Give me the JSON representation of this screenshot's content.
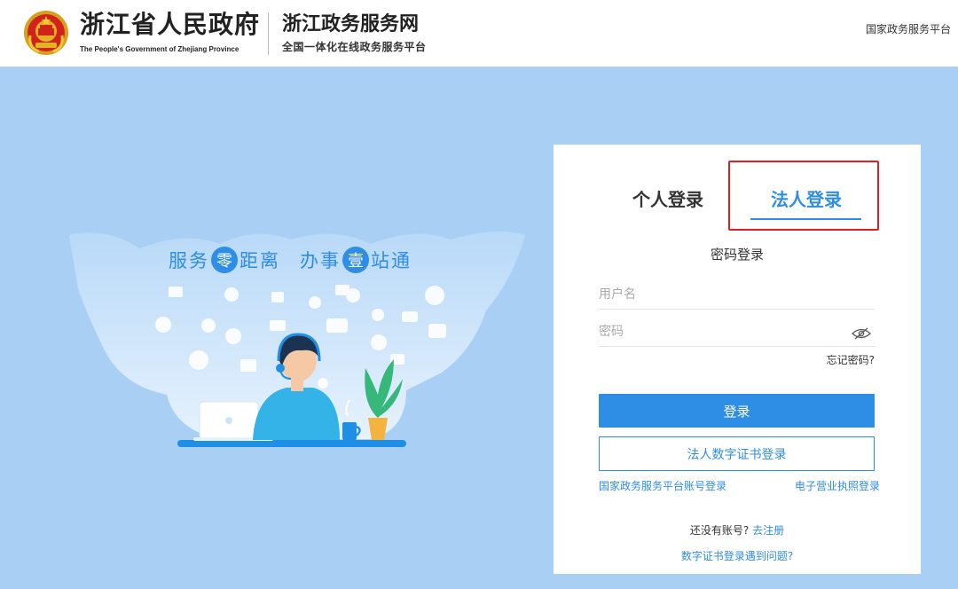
{
  "header": {
    "gov_name": "浙江省人民政府",
    "gov_name_en": "The People's Government of Zhejiang Province",
    "site_name": "浙江政务服务网",
    "site_subtitle": "全国一体化在线政务服务平台",
    "national_platform_link": "国家政务服务平台",
    "emblem_icon": "national-emblem-icon"
  },
  "banner": {
    "slogan_part1": "服务",
    "slogan_circle1": "零",
    "slogan_part2": "距离",
    "slogan_part3": "办事",
    "slogan_circle2": "壹",
    "slogan_part4": "站通"
  },
  "login": {
    "tabs": [
      {
        "label": "个人登录",
        "active": false
      },
      {
        "label": "法人登录",
        "active": true
      }
    ],
    "mode_label": "密码登录",
    "username_placeholder": "用户名",
    "password_placeholder": "密码",
    "forgot_password": "忘记密码?",
    "login_button": "登录",
    "cert_login_button": "法人数字证书登录",
    "national_account_login": "国家政务服务平台账号登录",
    "business_license_login": "电子营业执照登录",
    "no_account_text": "还没有账号?",
    "register_link": "去注册",
    "cert_problem_link": "数字证书登录遇到问题?"
  },
  "colors": {
    "background": "#a9cff5",
    "accent": "#2e8de5",
    "highlight_border": "#e02020"
  }
}
